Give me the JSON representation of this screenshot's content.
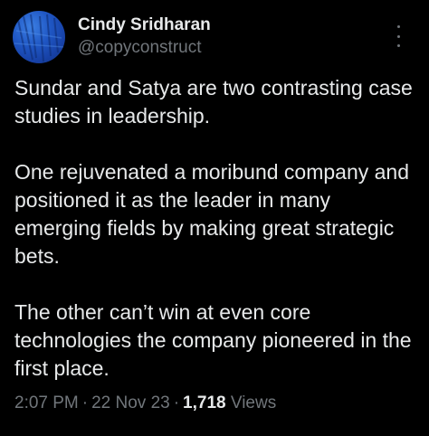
{
  "author": {
    "display_name": "Cindy Sridharan",
    "handle": "@copyconstruct"
  },
  "tweet": {
    "paragraphs": [
      "Sundar and Satya are two contrasting case studies in leadership.",
      "One rejuvenated a moribund company and positioned it as the leader in many emerging fields by making great strategic bets.",
      "The other can’t win at even core technologies the company pioneered in the first place."
    ]
  },
  "meta": {
    "time": "2:07 PM",
    "separator": "·",
    "date": "22 Nov 23",
    "views_count": "1,718",
    "views_label": "Views"
  },
  "icons": {
    "more": "more-vertical-icon"
  },
  "colors": {
    "background": "#000000",
    "text_primary": "#e7e9ea",
    "text_secondary": "#71767b",
    "avatar": "#1f56c3"
  }
}
